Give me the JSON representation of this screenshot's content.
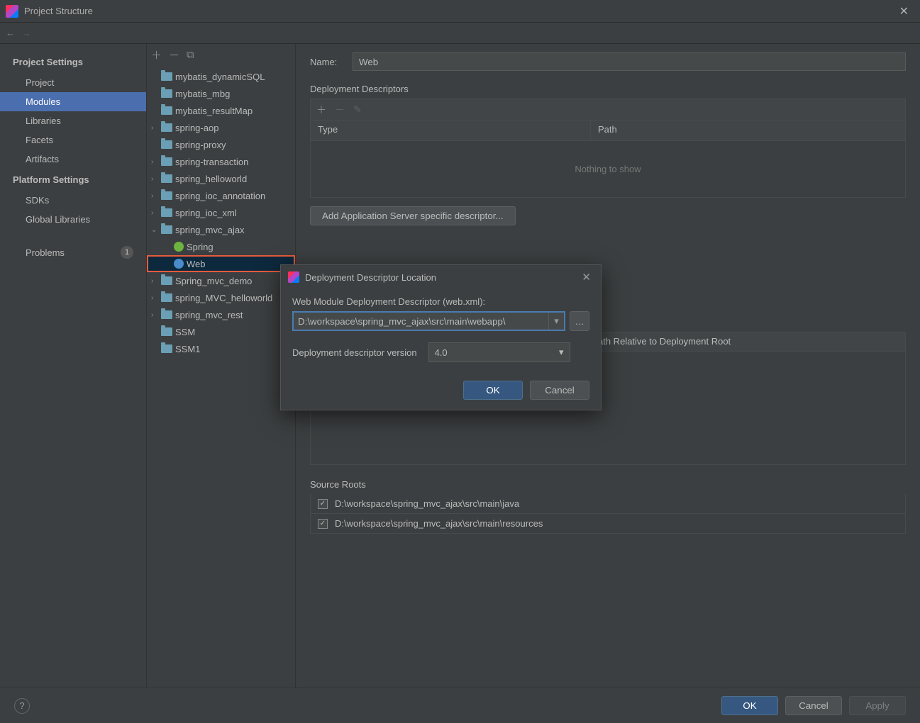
{
  "window": {
    "title": "Project Structure"
  },
  "nav": {
    "sections": [
      {
        "title": "Project Settings",
        "items": [
          "Project",
          "Modules",
          "Libraries",
          "Facets",
          "Artifacts"
        ],
        "selected": "Modules"
      },
      {
        "title": "Platform Settings",
        "items": [
          "SDKs",
          "Global Libraries"
        ]
      }
    ],
    "problems_label": "Problems",
    "problems_count": "1"
  },
  "tree": [
    {
      "label": "mybatis_dynamicSQL",
      "indent": 1,
      "expander": ""
    },
    {
      "label": "mybatis_mbg",
      "indent": 1,
      "expander": ""
    },
    {
      "label": "mybatis_resultMap",
      "indent": 1,
      "expander": ""
    },
    {
      "label": "spring-aop",
      "indent": 1,
      "expander": "›"
    },
    {
      "label": "spring-proxy",
      "indent": 1,
      "expander": ""
    },
    {
      "label": "spring-transaction",
      "indent": 1,
      "expander": "›"
    },
    {
      "label": "spring_helloworld",
      "indent": 1,
      "expander": "›"
    },
    {
      "label": "spring_ioc_annotation",
      "indent": 1,
      "expander": "›"
    },
    {
      "label": "spring_ioc_xml",
      "indent": 1,
      "expander": "›"
    },
    {
      "label": "spring_mvc_ajax",
      "indent": 1,
      "expander": "⌄",
      "expanded": true
    },
    {
      "label": "Spring",
      "indent": 2,
      "icon": "spring",
      "expander": ""
    },
    {
      "label": "Web",
      "indent": 2,
      "icon": "web",
      "expander": "",
      "selected": true,
      "highlighted": true
    },
    {
      "label": "Spring_mvc_demo",
      "indent": 1,
      "expander": "›"
    },
    {
      "label": "spring_MVC_helloworld",
      "indent": 1,
      "expander": "›"
    },
    {
      "label": "spring_mvc_rest",
      "indent": 1,
      "expander": "›"
    },
    {
      "label": "SSM",
      "indent": 1,
      "expander": ""
    },
    {
      "label": "SSM1",
      "indent": 1,
      "expander": ""
    }
  ],
  "content": {
    "name_label": "Name:",
    "name_value": "Web",
    "deployment_descriptors_title": "Deployment Descriptors",
    "table_headers": {
      "type": "Type",
      "path": "Path"
    },
    "table_empty": "Nothing to show",
    "add_server_descriptor_btn": "Add Application Server specific descriptor...",
    "web_resource_header": "ath Relative to Deployment Root",
    "source_roots_title": "Source Roots",
    "source_roots": [
      "D:\\workspace\\spring_mvc_ajax\\src\\main\\java",
      "D:\\workspace\\spring_mvc_ajax\\src\\main\\resources"
    ]
  },
  "modal": {
    "title": "Deployment Descriptor Location",
    "field_label": "Web Module Deployment Descriptor (web.xml):",
    "path_value": "D:\\workspace\\spring_mvc_ajax\\src\\main\\webapp\\",
    "version_label": "Deployment descriptor version",
    "version_value": "4.0",
    "ok": "OK",
    "cancel": "Cancel"
  },
  "footer": {
    "ok": "OK",
    "cancel": "Cancel",
    "apply": "Apply"
  }
}
